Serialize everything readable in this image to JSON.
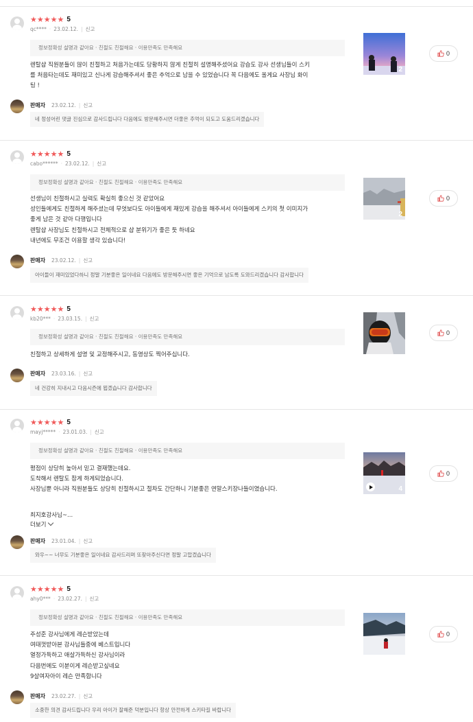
{
  "colors": {
    "star": "#f05a5a",
    "tag_bg": "#f6f6f6",
    "divider": "#e6e6e6"
  },
  "reviews": [
    {
      "stars": "★★★★★",
      "score": "5",
      "user": "qc****",
      "date": "23.02.12.",
      "report": "신고",
      "tags": "정보정확성 설명과 같아요 · 친절도 친절해요 · 이용만족도 만족해요",
      "body": [
        "렌탈샵 직원분들이 많이 친절하고 처음가는데도 당황하지 않게 친절히 설명해주셨어요 강습도 강사 선생님들이 스키",
        "를 처음타는데도 재미있고 신나게 강습해주셔서 좋은 추억으로 남을 수 있었습니다 꼭 다음에도 올게요 사장님 화이",
        "팅 !"
      ],
      "photo_count": "2",
      "likes": "0",
      "seller": {
        "name": "판매자",
        "date": "23.02.12.",
        "report": "신고",
        "reply": "네 정성어린 댓글 진심으로 감사드립니다 다음에도 방문해주시면 더좋은 추억이 되도고 도움드리겠습니다"
      }
    },
    {
      "stars": "★★★★★",
      "score": "5",
      "user": "cabo******",
      "date": "23.02.12.",
      "report": "신고",
      "tags": "정보정확성 설명과 같아요 · 친절도 친절해요 · 이용만족도 만족해요",
      "body": [
        "선생님이 친절하시고 실력도 확실히 좋으신 것 같았어요",
        "성인들에게도 친절하게 해주셨는데 무엇보다도 아이들에게 재밌게 강습을 해주셔서 아이들에게 스키의 첫 이미지가",
        "좋게 남은 것 같아 다행입니다",
        "렌탈샵 사장님도 친절하시고 전체적으로 샵 분위기가 좋은 듯 하네요",
        "내년에도 무조건 이용할 생각 있습니다!"
      ],
      "photo_count": "2",
      "likes": "0",
      "seller": {
        "name": "판매자",
        "date": "23.02.12.",
        "report": "신고",
        "reply": "아이들이 재미있었다하니 정말 기분좋은 일이네요 다음에도 방문해주시면 좋은 기억으로 남도록 도와드리겠습니다 감사합니다"
      }
    },
    {
      "stars": "★★★★★",
      "score": "5",
      "user": "kb20***",
      "date": "23.03.15.",
      "report": "신고",
      "tags": "정보정확성 설명과 같아요 · 친절도 친절해요 · 이용만족도 만족해요",
      "body": [
        "친절하고 상세하게 설명 및 교정해주시고, 동영상도 찍어주십니다."
      ],
      "photo_count": "",
      "likes": "0",
      "seller": {
        "name": "판매자",
        "date": "23.03.16.",
        "report": "신고",
        "reply": "네 건강히 지내시고 다음시즌에 뵙겠습니다 감사합니다"
      }
    },
    {
      "stars": "★★★★★",
      "score": "5",
      "user": "mayj*****",
      "date": "23.01.03.",
      "report": "신고",
      "tags": "정보정확성 설명과 같아요 · 친절도 친절해요 · 이용만족도 만족해요",
      "body": [
        "평점이 상당히 높아서 믿고 결재했는데요.",
        "도착해서 렌탈도 참게 하게되었습니다.",
        "사장님뿐 아니라 직원분들도 상당히 친절하시고 절차도 간단하니 기분좋은 연말스키장나들이였습니다.",
        "",
        "최지호강사님~..."
      ],
      "more": "더보기",
      "photo_count": "4",
      "likes": "0",
      "seller": {
        "name": "판매자",
        "date": "23.01.04.",
        "report": "신고",
        "reply": "와우~~ 너무도 기분좋은 일이네요 감사드리며 또찾아주신다면 정말 고맙겠습니다"
      }
    },
    {
      "stars": "★★★★★",
      "score": "5",
      "user": "ahy0***",
      "date": "23.02.27.",
      "report": "신고",
      "tags": "정보정확성 설명과 같아요 · 친절도 친절해요 · 이용만족도 만족해요",
      "body": [
        "주성준 강사님에게 레슨받았는데",
        "여태껏받아본 강사님들중에 베스트입니다",
        "열정가득하고 애살가득하신 강사님이라",
        "다음번에도 이분이게 레슨받고싶네요",
        "9살여자아이 레슨 만족합니다"
      ],
      "photo_count": "",
      "likes": "0",
      "seller": {
        "name": "판매자",
        "date": "23.02.27.",
        "report": "신고",
        "reply": "소중한 의견 감사드립니다 우리 아이가 잘해준 덕분입니다 항상 안전하게 스키타길 바랍니다"
      }
    }
  ]
}
